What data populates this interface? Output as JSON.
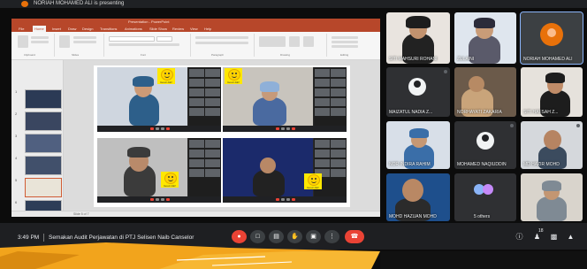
{
  "top_bar": {
    "presenter_label": "NORIAH MOHAMED ALI is presenting"
  },
  "ppt": {
    "tabs": [
      "File",
      "Home",
      "Insert",
      "Draw",
      "Design",
      "Transitions",
      "Animations",
      "Slide Show",
      "Review",
      "View",
      "Help"
    ],
    "ribbon_captions": [
      "Clipboard",
      "Slides",
      "Font",
      "Paragraph",
      "Drawing",
      "Editing"
    ],
    "thumb_numbers": [
      "1",
      "2",
      "3",
      "4",
      "5",
      "6",
      "7"
    ],
    "snapshot_smiley_text": "Good Job!"
  },
  "tiles": [
    {
      "name": "SITI MAHSURI ROHANI"
    },
    {
      "name": "ZULAINI"
    },
    {
      "name": "NORIAH MOHAMED ALI"
    },
    {
      "name": "MAIZATUL NADIA Z..."
    },
    {
      "name": "NORHAYATI ZAKARIA"
    },
    {
      "name": "SITI HAFSAH Z..."
    },
    {
      "name": "NOR INDIRA RAHIM"
    },
    {
      "name": "MOHAMED NAQIUDDIN"
    },
    {
      "name": "MD HAZIR MOHD"
    },
    {
      "name": "MOHD HAZUAN MOHD"
    },
    {
      "name": "5 others"
    },
    {
      "name": ""
    }
  ],
  "bottom_bar": {
    "time": "3:49 PM",
    "meeting_title": "Semakan Audit Perjawatan di PTJ Selisen Naib Canselor",
    "participant_count": "18"
  },
  "icons": {
    "mic": "mic-icon",
    "camera": "camera-icon",
    "captions": "captions-icon",
    "raise_hand": "hand-icon",
    "present": "present-icon",
    "more": "more-vert-icon",
    "end_call": "end-call-icon",
    "info": "info-icon",
    "people": "people-icon",
    "chat": "chat-icon",
    "activities": "activities-icon"
  },
  "colors": {
    "end_call": "#ea4335",
    "ppt_accent": "#b7472a",
    "active_speaker": "#8ab4f8"
  }
}
